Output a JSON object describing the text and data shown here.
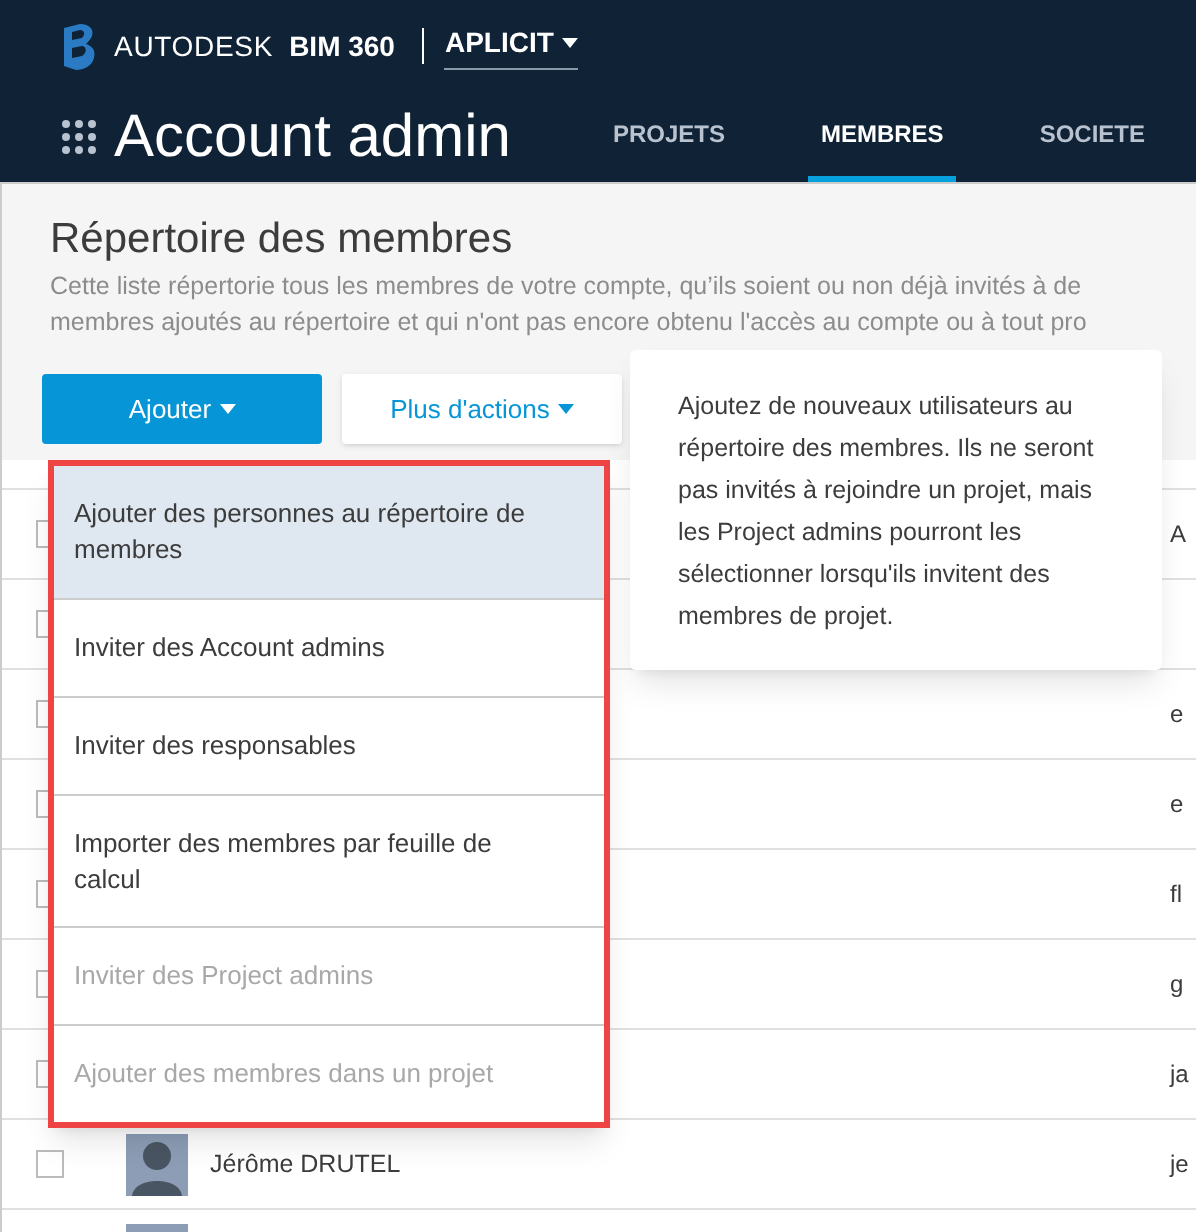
{
  "header": {
    "brand": "AUTODESK",
    "product": "BIM 360",
    "account": "APLICIT"
  },
  "title": "Account admin",
  "tabs": [
    {
      "label": "PROJETS",
      "selected": false
    },
    {
      "label": "MEMBRES",
      "selected": true
    },
    {
      "label": "SOCIETE",
      "selected": false
    }
  ],
  "page": {
    "heading": "Répertoire des membres",
    "description": [
      "Cette liste répertorie tous les membres de votre compte, qu’ils soient ou non déjà invités à de",
      "membres ajoutés au répertoire et qui n'ont pas encore obtenu l'accès au compte ou à tout pro"
    ]
  },
  "buttons": {
    "add": "Ajouter",
    "more": "Plus d'actions"
  },
  "menu": [
    {
      "label": "Ajouter des personnes au répertoire de membres",
      "selected": true,
      "disabled": false
    },
    {
      "label": "Inviter des Account admins",
      "selected": false,
      "disabled": false
    },
    {
      "label": "Inviter des responsables",
      "selected": false,
      "disabled": false
    },
    {
      "label": "Importer des membres par feuille de calcul",
      "selected": false,
      "disabled": false
    },
    {
      "label": "Inviter des Project admins",
      "selected": false,
      "disabled": true
    },
    {
      "label": "Ajouter des membres dans un projet",
      "selected": false,
      "disabled": true
    }
  ],
  "tooltip": "Ajoutez de nouveaux utilisateurs au répertoire des membres. Ils ne seront pas invités à rejoindre un projet, mais les Project admins pourront les sélectionner lorsqu'ils invitent des membres de projet.",
  "rows": [
    {
      "checked": false,
      "column_3": "A"
    },
    {
      "checked": false
    },
    {
      "checked": false,
      "column_3": "e"
    },
    {
      "checked": false,
      "column_3": "e"
    },
    {
      "checked": false,
      "column_3": "fl"
    },
    {
      "checked": false,
      "column_3": "g"
    },
    {
      "checked": false,
      "column_3": "ja"
    },
    {
      "checked": false,
      "name": "Jérôme DRUTEL",
      "column_3": "je",
      "avatar": true
    },
    {
      "avatar": true
    }
  ]
}
